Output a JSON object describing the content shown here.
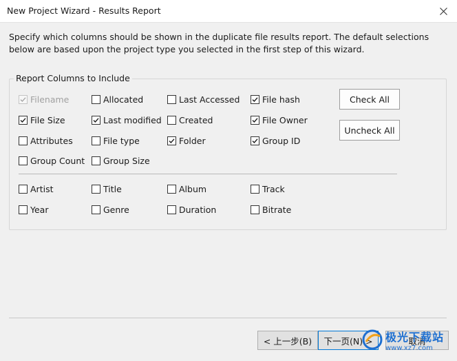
{
  "window": {
    "title": "New Project Wizard - Results Report",
    "description": "Specify which columns should be shown in the duplicate file results report. The default selections below are based upon the project type you selected in the first step of this wizard."
  },
  "group": {
    "label": "Report Columns to Include",
    "columns": [
      {
        "label": "Filename",
        "checked": true,
        "disabled": true
      },
      {
        "label": "Allocated",
        "checked": false
      },
      {
        "label": "Last Accessed",
        "checked": false
      },
      {
        "label": "File hash",
        "checked": true
      },
      {
        "label": "File Size",
        "checked": true
      },
      {
        "label": "Last modified",
        "checked": true
      },
      {
        "label": "Created",
        "checked": false
      },
      {
        "label": "File Owner",
        "checked": true
      },
      {
        "label": "Attributes",
        "checked": false
      },
      {
        "label": "File type",
        "checked": false
      },
      {
        "label": "Folder",
        "checked": true
      },
      {
        "label": "Group ID",
        "checked": true
      },
      {
        "label": "Group Count",
        "checked": false
      },
      {
        "label": "Group Size",
        "checked": false
      }
    ],
    "media_columns": [
      {
        "label": "Artist",
        "checked": false
      },
      {
        "label": "Title",
        "checked": false
      },
      {
        "label": "Album",
        "checked": false
      },
      {
        "label": "Track",
        "checked": false
      },
      {
        "label": "Year",
        "checked": false
      },
      {
        "label": "Genre",
        "checked": false
      },
      {
        "label": "Duration",
        "checked": false
      },
      {
        "label": "Bitrate",
        "checked": false
      }
    ]
  },
  "side_buttons": {
    "check_all": "Check All",
    "uncheck_all": "Uncheck All"
  },
  "footer": {
    "back": "< 上一步(B)",
    "next": "下一页(N) >",
    "cancel": "取消"
  },
  "watermark": {
    "main": "极光下载站",
    "sub": "www.xz7.com"
  },
  "colors": {
    "accent": "#1e6fd0",
    "dialog_bg": "#f0f0f0"
  }
}
